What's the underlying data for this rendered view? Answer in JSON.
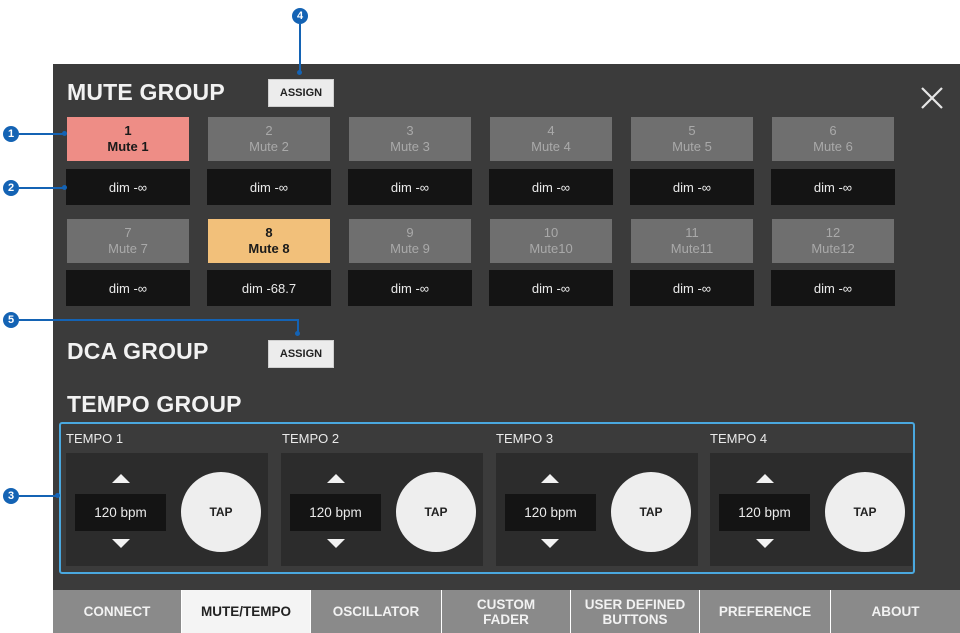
{
  "colors": {
    "panel_bg": "#3b3b3b",
    "mute_active_red": "#ee8d86",
    "mute_active_orange": "#f2c07a",
    "accent_blue": "#4aa8df",
    "callout_blue": "#1463b4"
  },
  "close_icon": "close-x-icon",
  "callouts": [
    "1",
    "2",
    "3",
    "4",
    "5"
  ],
  "mute_group": {
    "title": "MUTE GROUP",
    "assign_label": "ASSIGN",
    "buttons": [
      {
        "number": "1",
        "name": "Mute 1",
        "dim": "dim -∞",
        "state": "active-red"
      },
      {
        "number": "2",
        "name": "Mute 2",
        "dim": "dim -∞",
        "state": "off"
      },
      {
        "number": "3",
        "name": "Mute 3",
        "dim": "dim -∞",
        "state": "off"
      },
      {
        "number": "4",
        "name": "Mute 4",
        "dim": "dim -∞",
        "state": "off"
      },
      {
        "number": "5",
        "name": "Mute 5",
        "dim": "dim -∞",
        "state": "off"
      },
      {
        "number": "6",
        "name": "Mute 6",
        "dim": "dim -∞",
        "state": "off"
      },
      {
        "number": "7",
        "name": "Mute 7",
        "dim": "dim -∞",
        "state": "off"
      },
      {
        "number": "8",
        "name": "Mute 8",
        "dim": "dim -68.7",
        "state": "active-orange"
      },
      {
        "number": "9",
        "name": "Mute 9",
        "dim": "dim -∞",
        "state": "off"
      },
      {
        "number": "10",
        "name": "Mute10",
        "dim": "dim -∞",
        "state": "off"
      },
      {
        "number": "11",
        "name": "Mute11",
        "dim": "dim -∞",
        "state": "off"
      },
      {
        "number": "12",
        "name": "Mute12",
        "dim": "dim -∞",
        "state": "off"
      }
    ]
  },
  "dca_group": {
    "title": "DCA GROUP",
    "assign_label": "ASSIGN"
  },
  "tempo_group": {
    "title": "TEMPO GROUP",
    "items": [
      {
        "label": "TEMPO 1",
        "bpm": "120 bpm",
        "tap_label": "TAP"
      },
      {
        "label": "TEMPO 2",
        "bpm": "120 bpm",
        "tap_label": "TAP"
      },
      {
        "label": "TEMPO 3",
        "bpm": "120 bpm",
        "tap_label": "TAP"
      },
      {
        "label": "TEMPO 4",
        "bpm": "120 bpm",
        "tap_label": "TAP"
      }
    ]
  },
  "tabs": [
    {
      "label": "CONNECT",
      "selected": false
    },
    {
      "label": "MUTE/TEMPO",
      "selected": true
    },
    {
      "label": "OSCILLATOR",
      "selected": false
    },
    {
      "label": "CUSTOM\nFADER",
      "selected": false
    },
    {
      "label": "USER DEFINED\nBUTTONS",
      "selected": false
    },
    {
      "label": "PREFERENCE",
      "selected": false
    },
    {
      "label": "ABOUT",
      "selected": false
    }
  ]
}
